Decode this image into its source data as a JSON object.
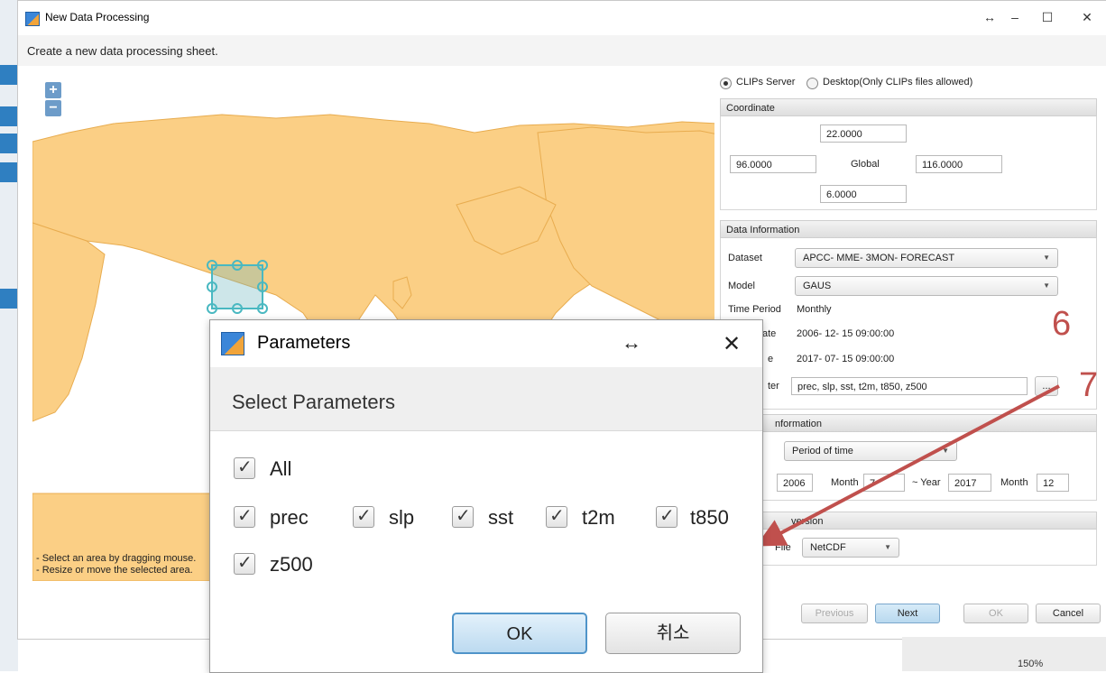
{
  "window": {
    "title": "New Data Processing",
    "subtitle": "Create a new data processing sheet.",
    "controls": {
      "resize": "↔",
      "minimize": "–",
      "maximize": "☐",
      "close": "✕"
    }
  },
  "map": {
    "zoom_in": "+",
    "zoom_out": "−",
    "notes": [
      "- Select an area by dragging mouse.",
      "- Resize or move the selected area."
    ],
    "land_color": "#fbcf85",
    "border_color": "#e8ac4f",
    "selection_color": "#49b8c1"
  },
  "source": {
    "options": [
      {
        "label": "CLIPs Server",
        "selected": true
      },
      {
        "label": "Desktop(Only CLIPs files allowed)",
        "selected": false
      }
    ]
  },
  "coordinate": {
    "header": "Coordinate",
    "north": "22.0000",
    "west": "96.0000",
    "center_label": "Global",
    "east": "116.0000",
    "south": "6.0000"
  },
  "data_information": {
    "header": "Data Information",
    "dataset_label": "Dataset",
    "dataset_value": "APCC- MME- 3MON- FORECAST",
    "model_label": "Model",
    "model_value": "GAUS",
    "time_period_label": "Time Period",
    "time_period_value": "Monthly",
    "start_label_partial": "ate",
    "start_value": "2006- 12- 15 09:00:00",
    "end_label_partial": "e",
    "end_value": "2017- 07- 15 09:00:00",
    "parameter_label_partial": "ter",
    "parameter_value": "prec, slp, sst, t2m, t850, z500",
    "browse_label": "..."
  },
  "period_information": {
    "header_partial": "nformation",
    "mode_value": "Period of time",
    "start_year": "2006",
    "month_label": "Month",
    "start_month": "7",
    "tilde_year_label": "~ Year",
    "end_year": "2017",
    "month_label_2": "Month",
    "end_month": "12"
  },
  "conversion": {
    "header_partial": "version",
    "file_label_partial": "File",
    "format_value": "NetCDF"
  },
  "footer_buttons": {
    "previous": "Previous",
    "next": "Next",
    "ok": "OK",
    "cancel": "Cancel"
  },
  "annotations": {
    "six": "6",
    "seven": "7",
    "arrow_color": "#c0504d"
  },
  "dialog": {
    "title": "Parameters",
    "resize_icon": "↔",
    "close": "✕",
    "header": "Select Parameters",
    "all_label": "All",
    "params": [
      "prec",
      "slp",
      "sst",
      "t2m",
      "t850",
      "z500"
    ],
    "ok": "OK",
    "cancel": "취소"
  },
  "background_app": {
    "zoom_text": "150%"
  }
}
